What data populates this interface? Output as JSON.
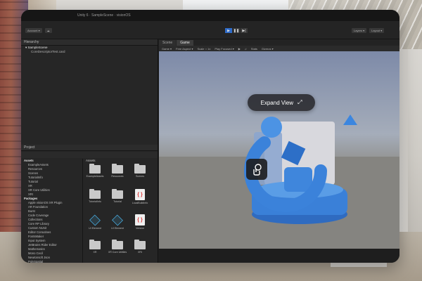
{
  "window": {
    "title": "Unity 6 · SampleScene · visionOS"
  },
  "toolbar": {
    "left_chips": [
      "Account ▾",
      "☁",
      "Layers ▾",
      "Layout ▾"
    ],
    "play_controls": [
      {
        "icon": "play-icon",
        "glyph": "▶",
        "active": true
      },
      {
        "icon": "pause-icon",
        "glyph": "❚❚",
        "active": false
      },
      {
        "icon": "step-icon",
        "glyph": "▶|",
        "active": false
      }
    ]
  },
  "hierarchy": {
    "header": "Hierarchy",
    "rows": [
      {
        "label": "SampleScene",
        "root": true
      },
      {
        "label": "CoreDescriptorTest.card",
        "root": false
      }
    ]
  },
  "project": {
    "header": "Project",
    "tree": [
      {
        "label": "Assets",
        "top": true
      },
      {
        "label": "ExampleAssets",
        "top": false
      },
      {
        "label": "Resources",
        "top": false
      },
      {
        "label": "Scenes",
        "top": false
      },
      {
        "label": "TutorialInfo",
        "top": false
      },
      {
        "label": "Tutorial",
        "top": false
      },
      {
        "label": "XR",
        "top": false
      },
      {
        "label": "XR Core Utilities",
        "top": false
      },
      {
        "label": "XRI",
        "top": false
      },
      {
        "label": "Packages",
        "top": true
      },
      {
        "label": "Apple visionOS XR Plugin",
        "top": false
      },
      {
        "label": "AR Foundation",
        "top": false
      },
      {
        "label": "Burst",
        "top": false
      },
      {
        "label": "Code Coverage",
        "top": false
      },
      {
        "label": "Collections",
        "top": false
      },
      {
        "label": "Core RP Library",
        "top": false
      },
      {
        "label": "Custom NUnit",
        "top": false
      },
      {
        "label": "Editor Coroutines",
        "top": false
      },
      {
        "label": "FontsMaker",
        "top": false
      },
      {
        "label": "Input System",
        "top": false
      },
      {
        "label": "JetBrains Rider Editor",
        "top": false
      },
      {
        "label": "Mathematics",
        "top": false
      },
      {
        "label": "Mono Cecil",
        "top": false
      },
      {
        "label": "Newtonsoft Json",
        "top": false
      },
      {
        "label": "PolySpatial",
        "top": false
      },
      {
        "label": "PolySpatial visionOS",
        "top": false
      },
      {
        "label": "PolySpatial XR",
        "top": false
      },
      {
        "label": "Profile Analyzer",
        "top": false
      },
      {
        "label": "Searcher",
        "top": false
      }
    ],
    "grid_label": "Assets",
    "assets": [
      {
        "type": "folder",
        "label": "ExampleAssets"
      },
      {
        "type": "folder",
        "label": "Resources"
      },
      {
        "type": "folder",
        "label": "Scenes"
      },
      {
        "type": "folder",
        "label": "TutorialInfo"
      },
      {
        "type": "folder",
        "label": "Tutorial"
      },
      {
        "type": "json",
        "label": "LocalBuildInfo"
      },
      {
        "type": "cube",
        "label": "UI Element"
      },
      {
        "type": "cube",
        "label": "UI Element"
      },
      {
        "type": "json",
        "label": "Version"
      },
      {
        "type": "folder",
        "label": "XR"
      },
      {
        "type": "folder",
        "label": "XR Core Utilities"
      },
      {
        "type": "folder",
        "label": "XRI"
      }
    ]
  },
  "scene": {
    "tabs": [
      {
        "label": "Scene",
        "active": false
      },
      {
        "label": "Game",
        "active": true
      }
    ],
    "toolbar": [
      "Game ▾",
      "Free Aspect ▾",
      "Scale ○ 1x",
      "Play Focused ▾",
      "▶",
      "♫",
      "Stats",
      "Gizmos ▾"
    ],
    "expand_label": "Expand View",
    "colors": {
      "accent_blue": "#3d8be0",
      "sky": "#7d8aa8",
      "ground": "#777570"
    }
  }
}
